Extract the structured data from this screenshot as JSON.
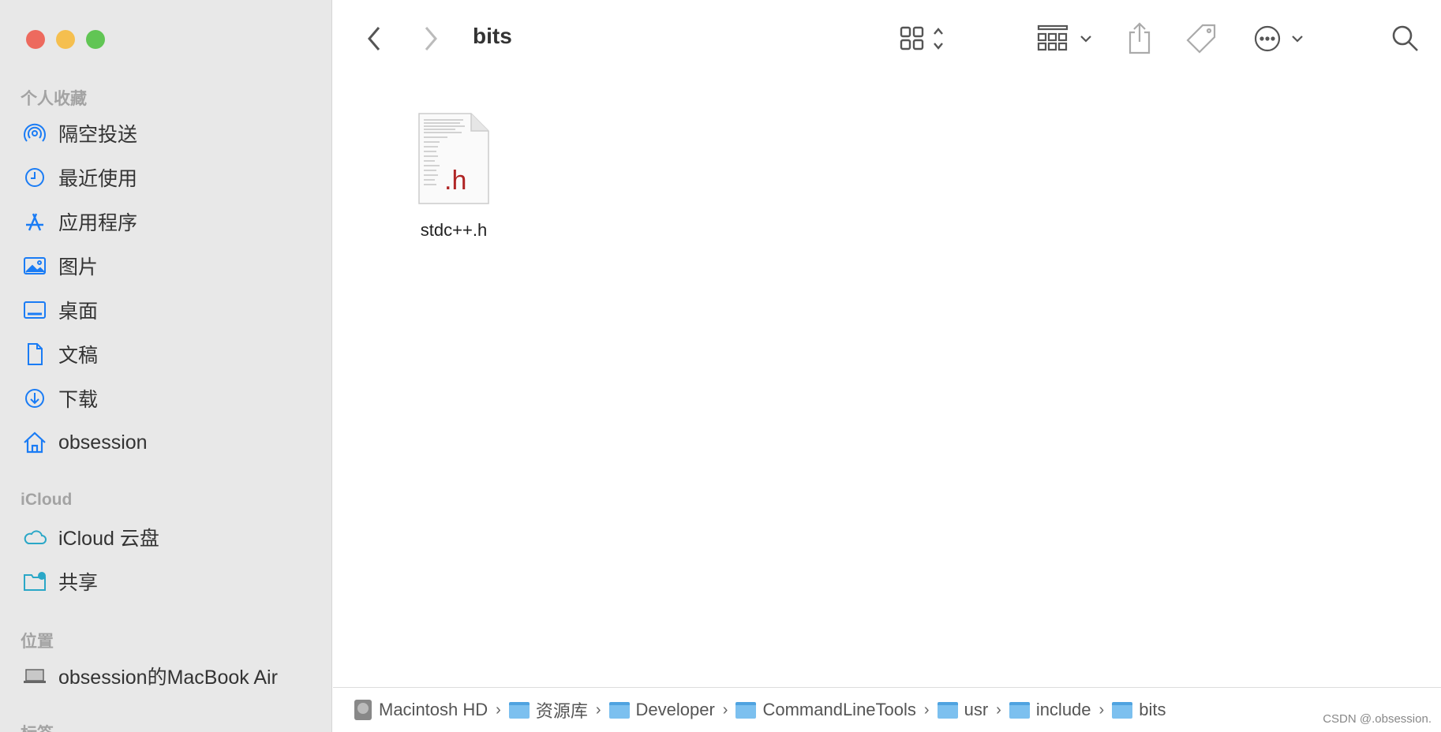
{
  "window": {
    "title": "bits"
  },
  "sidebar": {
    "sections": [
      {
        "header": "个人收藏",
        "items": [
          {
            "label": "隔空投送",
            "icon": "airdrop-icon"
          },
          {
            "label": "最近使用",
            "icon": "clock-icon"
          },
          {
            "label": "应用程序",
            "icon": "applications-icon"
          },
          {
            "label": "图片",
            "icon": "photo-icon"
          },
          {
            "label": "桌面",
            "icon": "desktop-icon"
          },
          {
            "label": "文稿",
            "icon": "document-icon"
          },
          {
            "label": "下载",
            "icon": "download-icon"
          },
          {
            "label": "obsession",
            "icon": "home-icon"
          }
        ]
      },
      {
        "header": "iCloud",
        "items": [
          {
            "label": "iCloud 云盘",
            "icon": "cloud-icon"
          },
          {
            "label": "共享",
            "icon": "shared-folder-icon"
          }
        ]
      },
      {
        "header": "位置",
        "items": [
          {
            "label": "obsession的MacBook Air",
            "icon": "laptop-icon"
          }
        ]
      },
      {
        "header": "标签",
        "items": []
      }
    ]
  },
  "files": [
    {
      "name": "stdc++.h",
      "ext": ".h"
    }
  ],
  "pathbar": [
    "Macintosh HD",
    "资源库",
    "Developer",
    "CommandLineTools",
    "usr",
    "include",
    "bits"
  ],
  "watermark": "CSDN @.obsession.",
  "colors": {
    "accent": "#1a7cf5",
    "close": "#ed6a5e",
    "minimize": "#f5bf4f",
    "zoom": "#61c554"
  }
}
